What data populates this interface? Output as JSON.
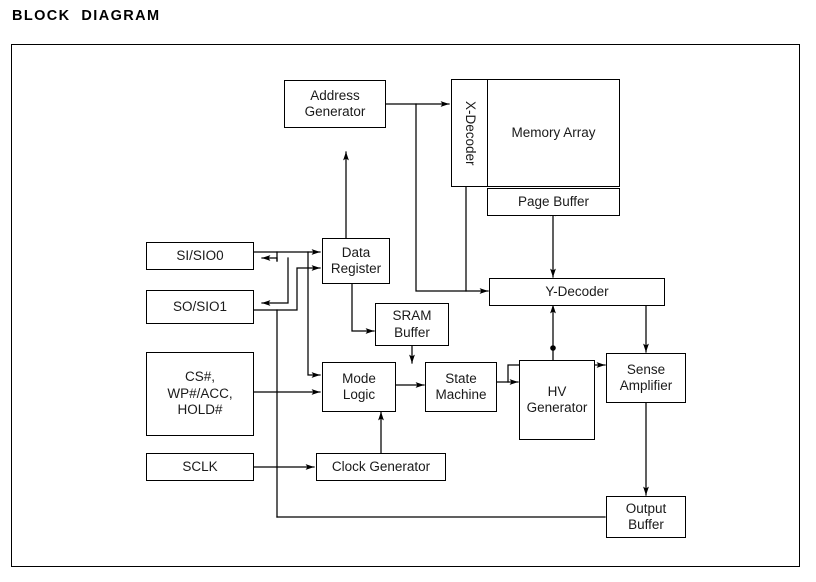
{
  "page": {
    "title": "BLOCK  DIAGRAM"
  },
  "diagram": {
    "type": "block-diagram",
    "blocks": {
      "address_generator": "Address\nGenerator",
      "x_decoder": "X-Decoder",
      "memory_array": "Memory Array",
      "page_buffer": "Page Buffer",
      "si_sio0": "SI/SIO0",
      "so_sio1": "SO/SIO1",
      "data_register": "Data\nRegister",
      "sram_buffer": "SRAM\nBuffer",
      "y_decoder": "Y-Decoder",
      "control_pins": "CS#,\nWP#/ACC,\nHOLD#",
      "mode_logic": "Mode\nLogic",
      "state_machine": "State\nMachine",
      "hv_generator": "HV\nGenerator",
      "sense_amplifier": "Sense\nAmplifier",
      "sclk": "SCLK",
      "clock_generator": "Clock Generator",
      "output_buffer": "Output\nBuffer"
    },
    "connections": [
      {
        "from": "si_sio0",
        "to": "data_register"
      },
      {
        "from": "so_sio1",
        "to": "data_register"
      },
      {
        "from": "data_register",
        "to": "si_sio0"
      },
      {
        "from": "data_register",
        "to": "so_sio1"
      },
      {
        "from": "data_register",
        "to": "address_generator",
        "style": "bidirectional"
      },
      {
        "from": "data_register",
        "to": "sram_buffer"
      },
      {
        "from": "address_generator",
        "to": "x_decoder"
      },
      {
        "from": "address_generator",
        "to": "y_decoder"
      },
      {
        "from": "x_decoder",
        "to": "y_decoder"
      },
      {
        "from": "page_buffer",
        "to": "y_decoder",
        "style": "bidirectional"
      },
      {
        "from": "y_decoder",
        "to": "sense_amplifier"
      },
      {
        "from": "sram_buffer",
        "to": "state_machine"
      },
      {
        "from": "control_pins",
        "to": "mode_logic"
      },
      {
        "from": "si_sio0",
        "to": "mode_logic"
      },
      {
        "from": "sclk",
        "to": "clock_generator"
      },
      {
        "from": "clock_generator",
        "to": "mode_logic"
      },
      {
        "from": "mode_logic",
        "to": "state_machine"
      },
      {
        "from": "state_machine",
        "to": "hv_generator"
      },
      {
        "from": "state_machine",
        "to": "sense_amplifier"
      },
      {
        "from": "hv_generator",
        "to": "y_decoder"
      },
      {
        "from": "sense_amplifier",
        "to": "output_buffer"
      },
      {
        "from": "output_buffer",
        "to": "data_register",
        "style": "feedback"
      }
    ],
    "colors": {
      "stroke": "#000000",
      "background": "#ffffff",
      "text": "#1a1a1a"
    }
  }
}
